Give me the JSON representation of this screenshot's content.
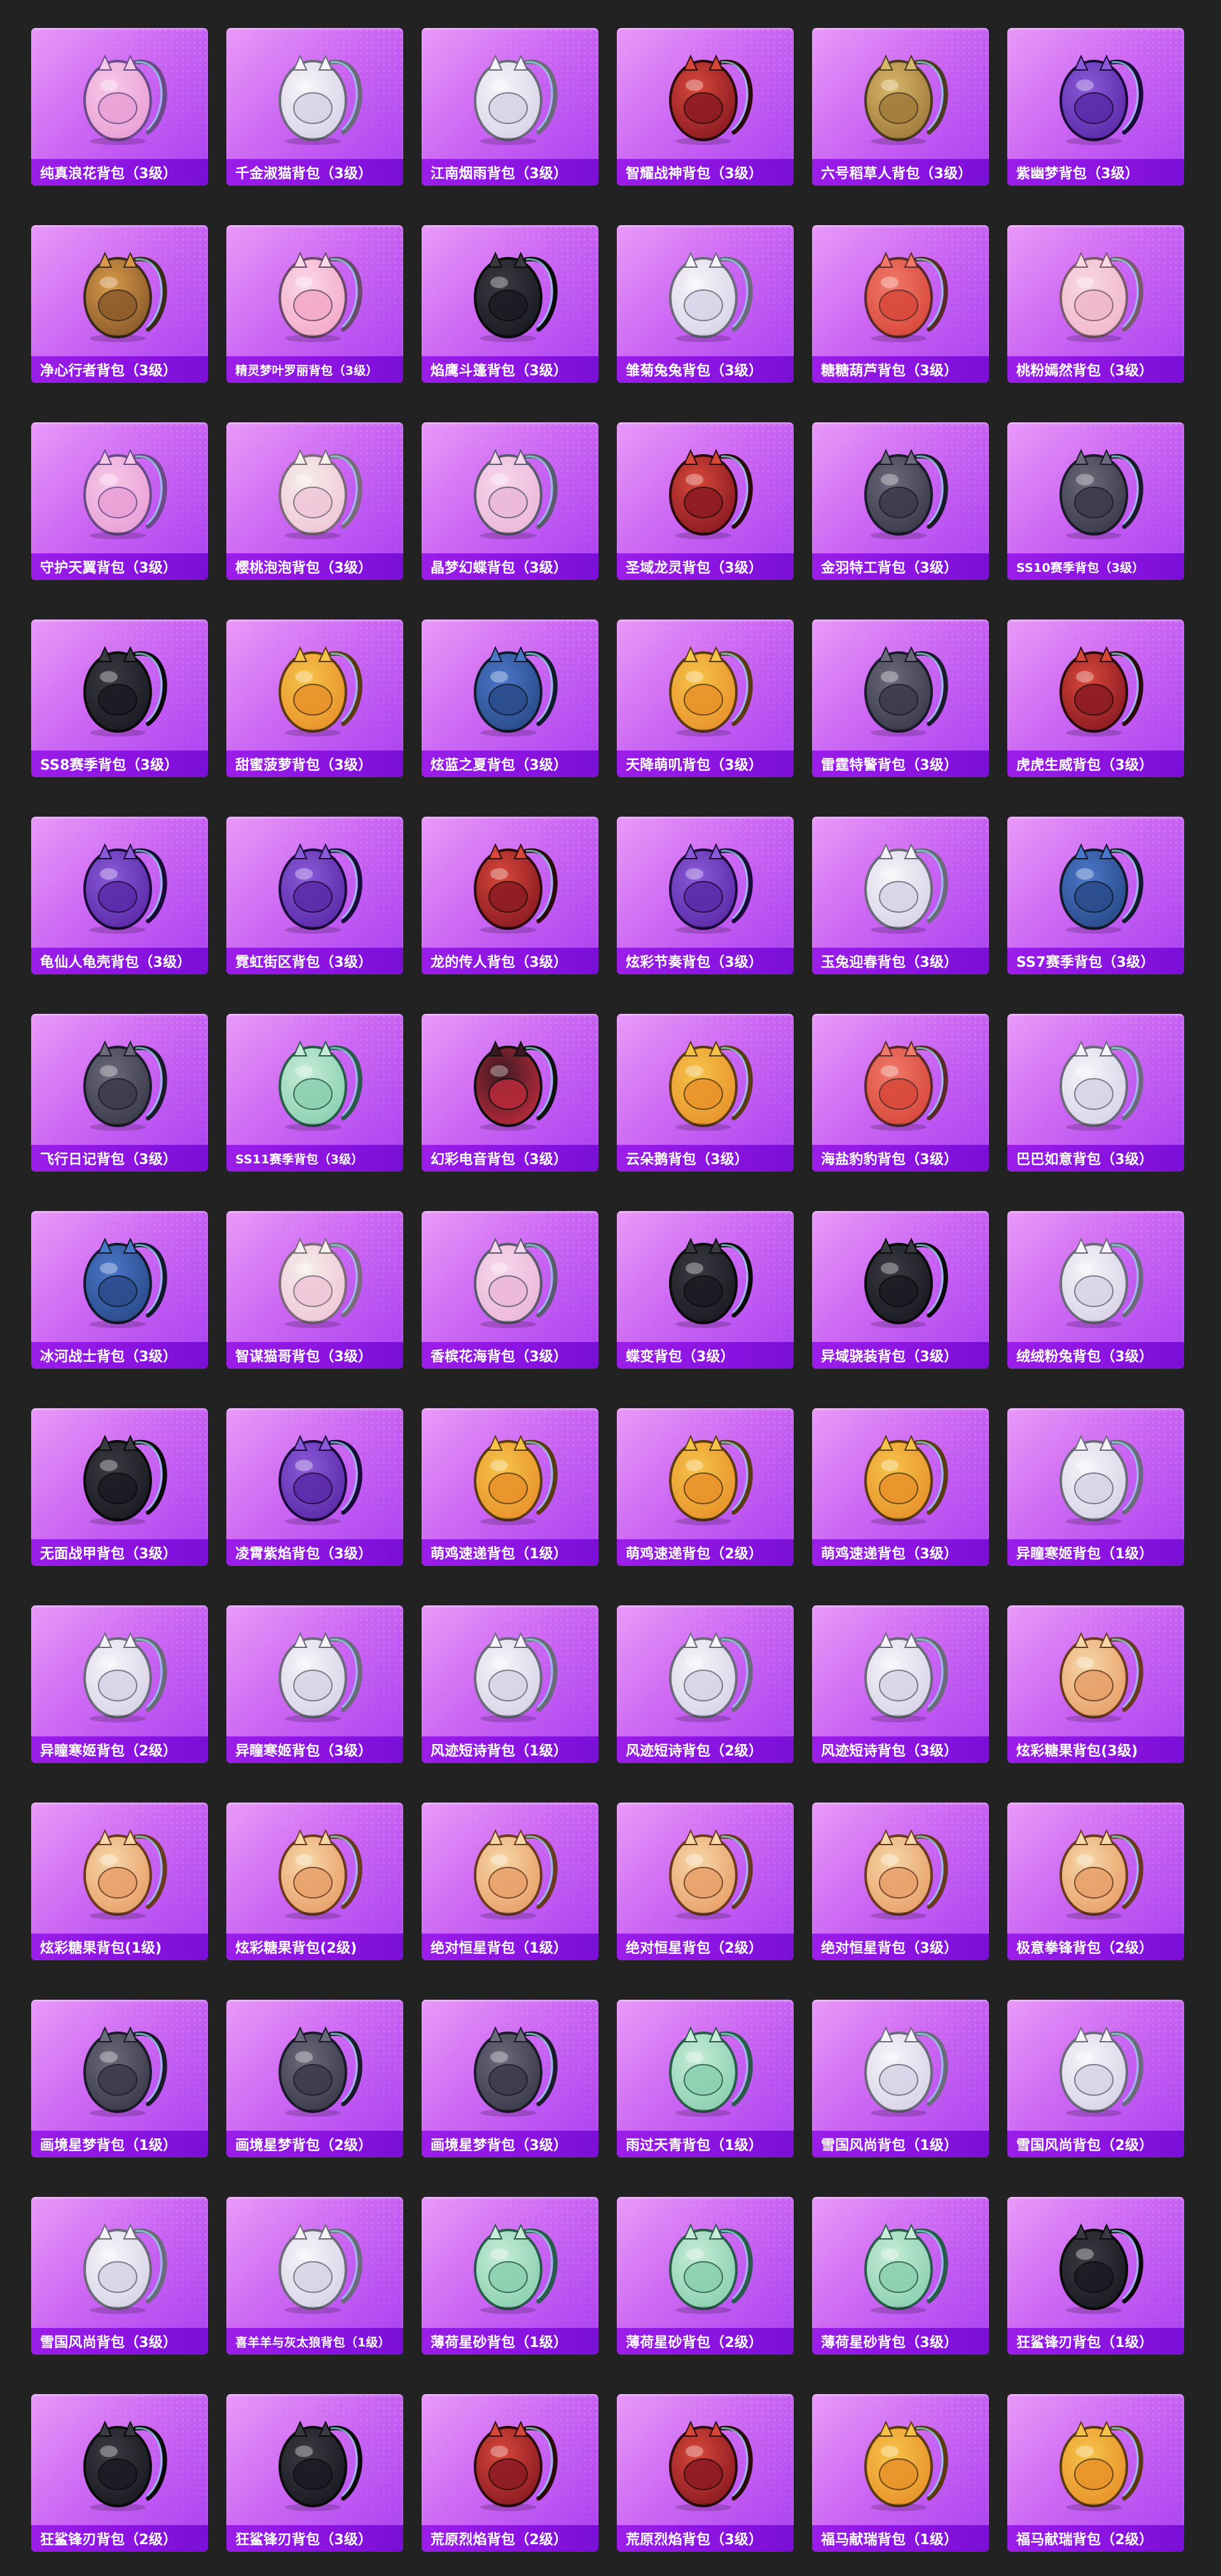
{
  "items": [
    {
      "name": "纯真浪花背包（3级）",
      "icon": "milk-tea-cup-backpack-icon"
    },
    {
      "name": "千金淑猫背包（3级）",
      "icon": "white-cat-backpack-icon"
    },
    {
      "name": "江南烟雨背包（3级）",
      "icon": "white-bunny-backpack-icon"
    },
    {
      "name": "智耀战神背包（3级）",
      "icon": "armored-backpack-icon"
    },
    {
      "name": "六号稻草人背包（3级）",
      "icon": "scarecrow-backpack-icon"
    },
    {
      "name": "紫幽梦背包（3级）",
      "icon": "purple-plush-backpack-icon"
    },
    {
      "name": "净心行者背包（3级）",
      "icon": "gourd-backpack-icon"
    },
    {
      "name": "精灵梦叶罗丽背包（3级）",
      "icon": "fairy-heart-backpack-icon"
    },
    {
      "name": "焰鹰斗篷背包（3级）",
      "icon": "red-black-cloak-backpack-icon"
    },
    {
      "name": "雏菊兔兔背包（3级）",
      "icon": "daisy-bunny-backpack-icon"
    },
    {
      "name": "糖糖葫芦背包（3级）",
      "icon": "candied-gourd-backpack-icon"
    },
    {
      "name": "桃粉嫣然背包（3级）",
      "icon": "peach-pink-plush-backpack-icon"
    },
    {
      "name": "守护天翼背包（3级）",
      "icon": "pink-wing-backpack-icon"
    },
    {
      "name": "樱桃泡泡背包（3级）",
      "icon": "bow-bag-backpack-icon"
    },
    {
      "name": "晶梦幻蝶背包（3级）",
      "icon": "butterfly-backpack-icon"
    },
    {
      "name": "圣域龙灵背包（3级）",
      "icon": "golden-dragon-backpack-icon"
    },
    {
      "name": "金羽特工背包（3级）",
      "icon": "tactical-backpack-icon"
    },
    {
      "name": "SS10赛季背包（3级）",
      "icon": "grey-plaid-backpack-icon"
    },
    {
      "name": "SS8赛季背包（3级）",
      "icon": "dark-grid-backpack-icon"
    },
    {
      "name": "甜蜜菠萝背包（3级）",
      "icon": "pineapple-backpack-icon"
    },
    {
      "name": "炫蓝之夏背包（3级）",
      "icon": "blue-tech-backpack-icon"
    },
    {
      "name": "天降萌叽背包（3级）",
      "icon": "yellow-backpack-icon"
    },
    {
      "name": "雷霆特警背包（3级）",
      "icon": "rusty-military-backpack-icon"
    },
    {
      "name": "虎虎生威背包（3级）",
      "icon": "red-tiger-backpack-icon"
    },
    {
      "name": "龟仙人龟壳背包（3级）",
      "icon": "turtle-shell-backpack-icon"
    },
    {
      "name": "霓虹街区背包（3级）",
      "icon": "neon-backpack-icon"
    },
    {
      "name": "龙的传人背包（3级）",
      "icon": "red-dragon-backpack-icon"
    },
    {
      "name": "炫彩节奏背包（3级）",
      "icon": "galaxy-backpack-icon"
    },
    {
      "name": "玉兔迎春背包（3级）",
      "icon": "red-white-rabbit-backpack-icon"
    },
    {
      "name": "SS7赛季背包（3级）",
      "icon": "blue-season-backpack-icon"
    },
    {
      "name": "飞行日记背包（3级）",
      "icon": "grey-shark-backpack-icon"
    },
    {
      "name": "SS11赛季背包（3级）",
      "icon": "teal-stripe-backpack-icon"
    },
    {
      "name": "幻彩电音背包（3级）",
      "icon": "speaker-disc-backpack-icon"
    },
    {
      "name": "云朵鹅背包（3级）",
      "icon": "yellow-duck-backpack-icon"
    },
    {
      "name": "海盐豹豹背包（3级）",
      "icon": "seal-backpack-icon"
    },
    {
      "name": "巴巴如意背包（3级）",
      "icon": "white-rabbit-plush-backpack-icon"
    },
    {
      "name": "冰河战士背包（3级）",
      "icon": "blue-owl-backpack-icon"
    },
    {
      "name": "智谋猫哥背包（3级）",
      "icon": "brown-cat-backpack-icon"
    },
    {
      "name": "香槟花海背包（3级）",
      "icon": "lace-pink-backpack-icon"
    },
    {
      "name": "蝶变背包（3级）",
      "icon": "black-butterfly-backpack-icon"
    },
    {
      "name": "异域骁装背包（3级）",
      "icon": "cyber-backpack-icon"
    },
    {
      "name": "绒绒粉兔背包（3级）",
      "icon": "pink-bunny-mirror-backpack-icon"
    },
    {
      "name": "无面战甲背包（3级）",
      "icon": "mask-armor-backpack-icon"
    },
    {
      "name": "凌霄紫焰背包（3级）",
      "icon": "purple-orb-backpack-icon"
    },
    {
      "name": "萌鸡速递背包（1级）",
      "icon": "chick-courier-lv1-icon"
    },
    {
      "name": "萌鸡速递背包（2级）",
      "icon": "chick-courier-lv2-icon"
    },
    {
      "name": "萌鸡速递背包（3级）",
      "icon": "chick-courier-lv3-icon"
    },
    {
      "name": "异瞳寒姬背包（1级）",
      "icon": "snow-maiden-lv1-icon"
    },
    {
      "name": "异瞳寒姬背包（2级）",
      "icon": "snow-maiden-lv2-icon"
    },
    {
      "name": "异瞳寒姬背包（3级）",
      "icon": "snow-maiden-lv3-icon"
    },
    {
      "name": "风迹短诗背包（1级）",
      "icon": "poem-bag-lv1-icon"
    },
    {
      "name": "风迹短诗背包（2级）",
      "icon": "poem-bag-lv2-icon"
    },
    {
      "name": "风迹短诗背包（3级）",
      "icon": "poem-bag-lv3-icon"
    },
    {
      "name": "炫彩糖果背包(3级)",
      "icon": "donut-lv3-icon"
    },
    {
      "name": "炫彩糖果背包(1级)",
      "icon": "donut-lv1-icon"
    },
    {
      "name": "炫彩糖果背包(2级)",
      "icon": "donut-lv2-icon"
    },
    {
      "name": "绝对恒星背包（1级）",
      "icon": "popcorn-lv1-icon"
    },
    {
      "name": "绝对恒星背包（2级）",
      "icon": "popcorn-lv2-icon"
    },
    {
      "name": "绝对恒星背包（3级）",
      "icon": "popcorn-lv3-icon"
    },
    {
      "name": "极意拳锋背包（2级）",
      "icon": "bottle-backpack-icon"
    },
    {
      "name": "画境星梦背包（1级）",
      "icon": "star-book-lv1-icon"
    },
    {
      "name": "画境星梦背包（2级）",
      "icon": "star-book-lv2-icon"
    },
    {
      "name": "画境星梦背包（3级）",
      "icon": "star-book-lv3-icon"
    },
    {
      "name": "雨过天青背包（1级）",
      "icon": "jade-pendant-backpack-icon"
    },
    {
      "name": "雪国风尚背包（1级）",
      "icon": "snow-bunny-lv1-icon"
    },
    {
      "name": "雪国风尚背包（2级）",
      "icon": "snow-bunny-lv2-icon"
    },
    {
      "name": "雪国风尚背包（3级）",
      "icon": "snow-bunny-lv3-icon"
    },
    {
      "name": "喜羊羊与灰太狼背包（1级）",
      "icon": "sheep-backpack-icon"
    },
    {
      "name": "薄荷星砂背包（1级）",
      "icon": "mint-sand-lv1-icon"
    },
    {
      "name": "薄荷星砂背包（2级）",
      "icon": "mint-sand-lv2-icon"
    },
    {
      "name": "薄荷星砂背包（3级）",
      "icon": "mint-sand-lv3-icon"
    },
    {
      "name": "狂鲨锋刃背包（1级）",
      "icon": "shark-blade-lv1-icon"
    },
    {
      "name": "狂鲨锋刃背包（2级）",
      "icon": "shark-blade-lv2-icon"
    },
    {
      "name": "狂鲨锋刃背包（3级）",
      "icon": "shark-blade-lv3-icon"
    },
    {
      "name": "荒原烈焰背包（2级）",
      "icon": "wasteland-flame-lv2-icon"
    },
    {
      "name": "荒原烈焰背包（3级）",
      "icon": "wasteland-flame-lv3-icon"
    },
    {
      "name": "福马献瑞背包（1级）",
      "icon": "lucky-horse-lv1-icon"
    },
    {
      "name": "福马献瑞背包（2级）",
      "icon": "lucky-horse-lv2-icon"
    }
  ],
  "palette": {
    "card_gradient": [
      "#e99af8",
      "#cc67f3",
      "#a93ff0"
    ],
    "label_bar": "#8a13e0",
    "page_bg": "#222222",
    "label_text": "#ffffff"
  }
}
